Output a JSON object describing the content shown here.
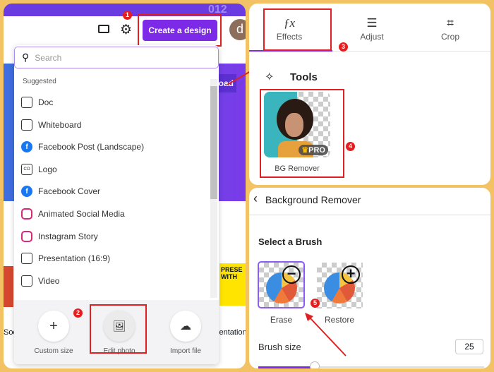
{
  "left": {
    "create_button": "Create a design",
    "avatar_letter": "d",
    "search_placeholder": "Search",
    "section_label": "Suggested",
    "items": [
      {
        "label": "Doc",
        "icon": "doc-icon"
      },
      {
        "label": "Whiteboard",
        "icon": "whiteboard-icon"
      },
      {
        "label": "Facebook Post (Landscape)",
        "icon": "facebook-icon"
      },
      {
        "label": "Logo",
        "icon": "logo-icon"
      },
      {
        "label": "Facebook Cover",
        "icon": "facebook-icon"
      },
      {
        "label": "Animated Social Media",
        "icon": "instagram-icon"
      },
      {
        "label": "Instagram Story",
        "icon": "instagram-icon"
      },
      {
        "label": "Presentation (16:9)",
        "icon": "presentation-icon"
      },
      {
        "label": "Video",
        "icon": "video-icon"
      }
    ],
    "actions": [
      {
        "label": "Custom size"
      },
      {
        "label": "Edit photo"
      },
      {
        "label": "Import file"
      }
    ],
    "bg_upload_fragment": "oad",
    "bg_text_left": "Soc",
    "bg_text_right": "sentation",
    "bg_thumb_text": "PRESE WITH",
    "banner_text": "012"
  },
  "top_right": {
    "tabs": [
      {
        "label": "Effects",
        "icon": "fx"
      },
      {
        "label": "Adjust"
      },
      {
        "label": "Crop"
      }
    ],
    "tools_heading": "Tools",
    "tool_label": "BG Remover",
    "pro_badge": "PRO"
  },
  "bottom_right": {
    "title": "Background Remover",
    "brush_heading": "Select a Brush",
    "brushes": [
      {
        "label": "Erase",
        "selected": true
      },
      {
        "label": "Restore",
        "selected": false
      }
    ],
    "brush_size_label": "Brush size",
    "brush_size_value": "25",
    "brush_size_fraction": 0.25
  },
  "badges": [
    "1",
    "2",
    "3",
    "4",
    "5"
  ],
  "colors": {
    "accent": "#7d2ae8",
    "annotation": "#e02020",
    "frame": "#f2c265"
  }
}
